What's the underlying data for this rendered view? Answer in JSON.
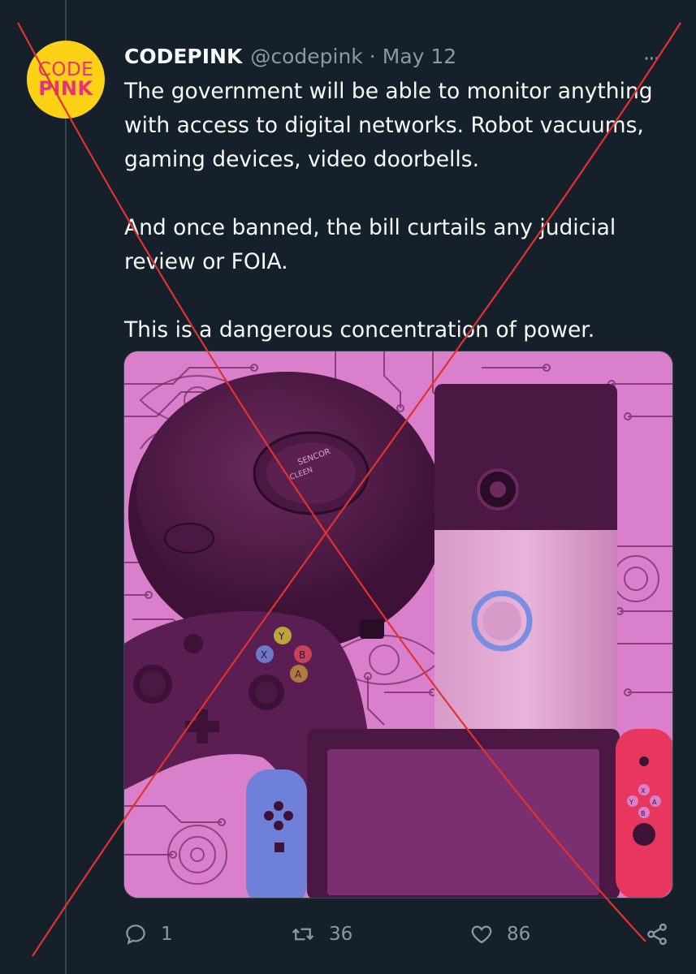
{
  "tweet": {
    "display_name": "CODEPINK",
    "handle": "@codepink",
    "separator": "·",
    "date": "May 12",
    "more_label": "···",
    "paragraphs": [
      "The government will be able to monitor anything with access to digital networks. Robot vacuums, gaming devices, video doorbells.",
      "And once banned, the bill curtails any judicial review or FOIA.",
      "This is a dangerous concentration of power."
    ]
  },
  "avatar": {
    "line1": "CODE",
    "line2": "PINK",
    "bg_color": "#fcd116",
    "text_color": "#e8327c"
  },
  "media": {
    "vacuum_label_1": "SENCOR",
    "vacuum_label_2": "CLEEN",
    "controller_buttons": {
      "y": "Y",
      "x": "X",
      "b": "B",
      "a": "A"
    },
    "joycon_buttons": {
      "x": "X",
      "y": "Y",
      "a": "A",
      "b": "B"
    },
    "tint_color": "#d77fc9"
  },
  "actions": {
    "reply_icon": "reply-icon",
    "reply_count": "1",
    "retweet_icon": "retweet-icon",
    "retweet_count": "36",
    "like_icon": "heart-icon",
    "like_count": "86",
    "share_icon": "share-icon"
  },
  "colors": {
    "background": "#15202b",
    "text": "#f7f9f9",
    "secondary": "#8b98a5",
    "x_overlay": "#e0332d"
  }
}
